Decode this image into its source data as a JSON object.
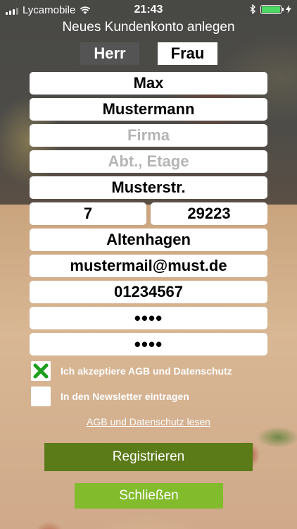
{
  "status_bar": {
    "carrier": "Lycamobile",
    "time": "21:43"
  },
  "header": {
    "title": "Neues Kundenkonto anlegen"
  },
  "gender": {
    "herr": "Herr",
    "frau": "Frau",
    "selected": "Frau"
  },
  "form": {
    "first_name": "Max",
    "last_name": "Mustermann",
    "company_placeholder": "Firma",
    "department_placeholder": "Abt., Etage",
    "street": "Musterstr.",
    "house_number": "7",
    "zip": "29223",
    "city": "Altenhagen",
    "email": "mustermail@must.de",
    "phone": "01234567",
    "password": "••••",
    "password_repeat": "••••"
  },
  "checkboxes": {
    "agb_label": "Ich akzeptiere AGB und Datenschutz",
    "agb_checked": true,
    "newsletter_label": "In den Newsletter eintragen",
    "newsletter_checked": false
  },
  "links": {
    "agb_link": "AGB und Datenschutz lesen"
  },
  "buttons": {
    "register": "Registrieren",
    "close": "Schließen"
  },
  "colors": {
    "register_bg": "#5b7a18",
    "close_bg": "#82bb2c",
    "check_mark": "#1e9e1e",
    "battery": "#4cd964"
  }
}
